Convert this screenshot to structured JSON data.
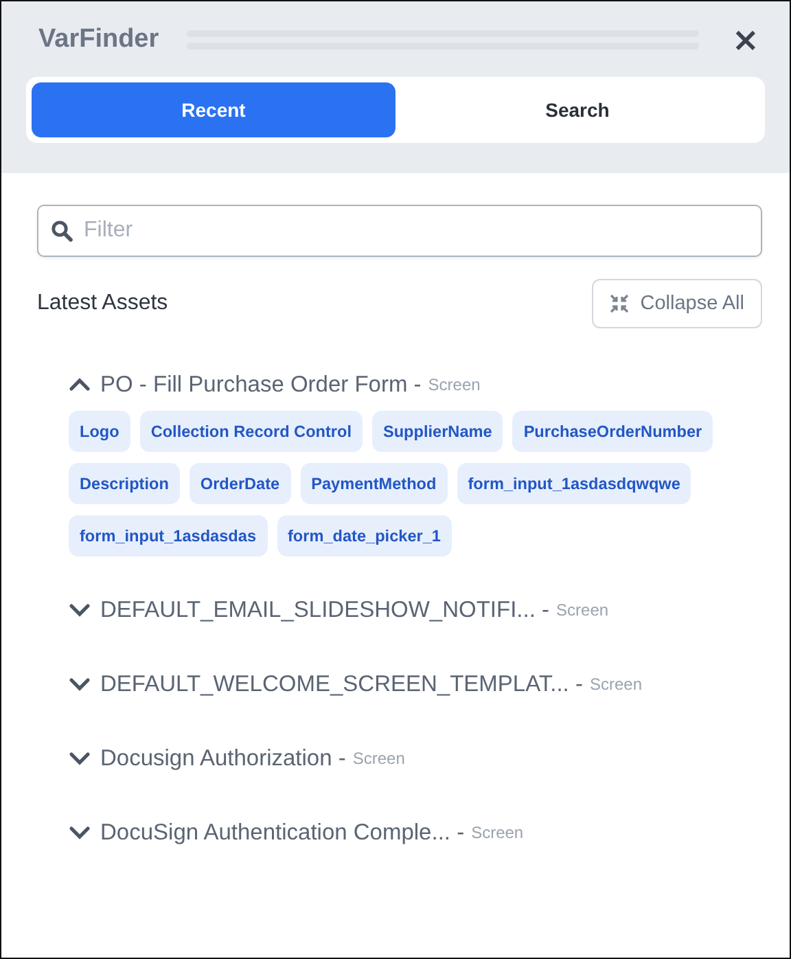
{
  "window": {
    "title": "VarFinder",
    "close": "×"
  },
  "tabs": [
    {
      "label": "Recent",
      "selected": true
    },
    {
      "label": "Search",
      "selected": false
    }
  ],
  "filter": {
    "placeholder": "Filter"
  },
  "section": {
    "title": "Latest Assets",
    "collapse_button": "Collapse All"
  },
  "assets": [
    {
      "name": "PO - Fill Purchase Order Form -",
      "type": "Screen",
      "expanded": true,
      "variables": [
        "Logo",
        "Collection Record Control",
        "SupplierName",
        "PurchaseOrderNumber",
        "Description",
        "OrderDate",
        "PaymentMethod",
        "form_input_1asdasdqwqwe",
        "form_input_1asdasdas",
        "form_date_picker_1"
      ]
    },
    {
      "name": "DEFAULT_EMAIL_SLIDESHOW_NOTIFI... -",
      "type": "Screen",
      "expanded": false
    },
    {
      "name": "DEFAULT_WELCOME_SCREEN_TEMPLAT... -",
      "type": "Screen",
      "expanded": false
    },
    {
      "name": "Docusign Authorization -",
      "type": "Screen",
      "expanded": false
    },
    {
      "name": "DocuSign Authentication Comple... -",
      "type": "Screen",
      "expanded": false
    }
  ]
}
